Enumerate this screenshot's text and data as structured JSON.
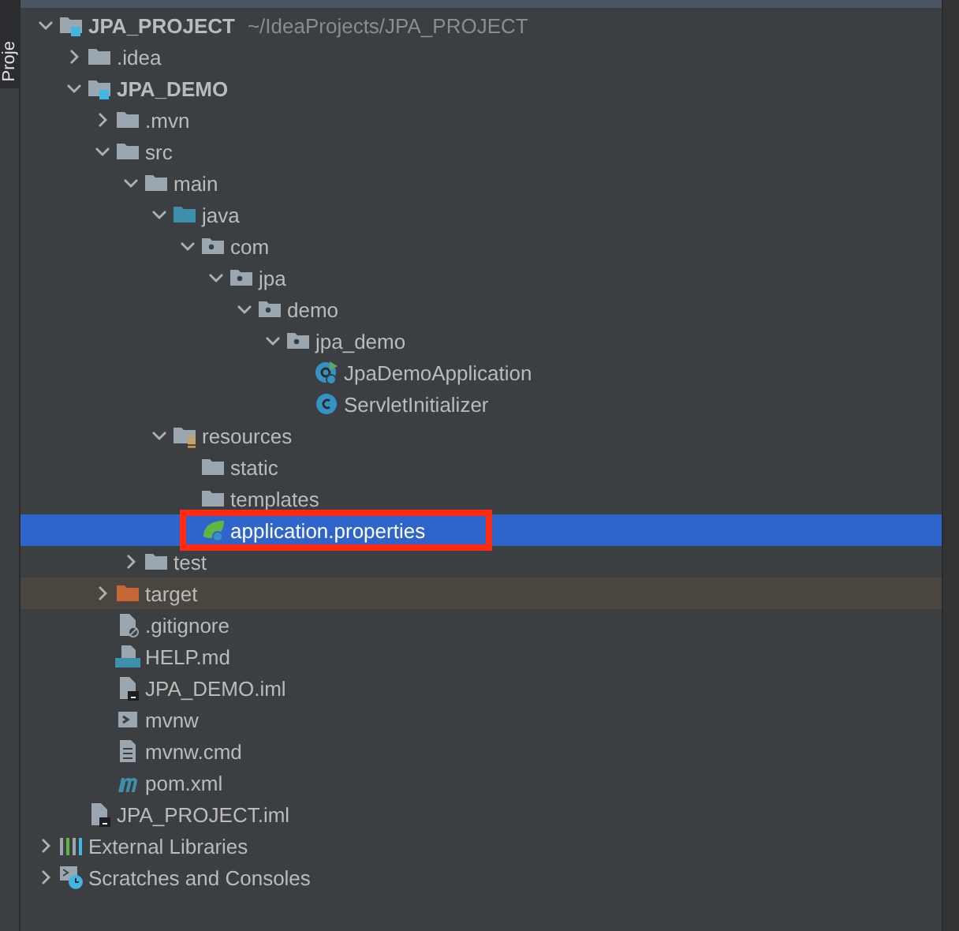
{
  "side_tab": {
    "label": "Proje"
  },
  "tree": [
    {
      "label": "JPA_PROJECT",
      "kind": "module",
      "path": "~/IdeaProjects/JPA_PROJECT",
      "expanded": true,
      "selected": false,
      "children": [
        {
          "label": ".idea",
          "kind": "folder",
          "expanded": false,
          "selected": false
        },
        {
          "label": "JPA_DEMO",
          "kind": "module",
          "expanded": true,
          "selected": false,
          "children": [
            {
              "label": ".mvn",
              "kind": "folder",
              "expanded": false,
              "selected": false
            },
            {
              "label": "src",
              "kind": "folder",
              "expanded": true,
              "selected": false,
              "children": [
                {
                  "label": "main",
                  "kind": "folder",
                  "expanded": true,
                  "selected": false,
                  "children": [
                    {
                      "label": "java",
                      "kind": "source",
                      "expanded": true,
                      "selected": false,
                      "children": [
                        {
                          "label": "com",
                          "kind": "package",
                          "expanded": true,
                          "selected": false,
                          "children": [
                            {
                              "label": "jpa",
                              "kind": "package",
                              "expanded": true,
                              "selected": false,
                              "children": [
                                {
                                  "label": "demo",
                                  "kind": "package",
                                  "expanded": true,
                                  "selected": false,
                                  "children": [
                                    {
                                      "label": "jpa_demo",
                                      "kind": "package",
                                      "expanded": true,
                                      "selected": false,
                                      "children": [
                                        {
                                          "label": "JpaDemoApplication",
                                          "kind": "main-class",
                                          "selected": false
                                        },
                                        {
                                          "label": "ServletInitializer",
                                          "kind": "class",
                                          "selected": false
                                        }
                                      ]
                                    }
                                  ]
                                }
                              ]
                            }
                          ]
                        }
                      ]
                    },
                    {
                      "label": "resources",
                      "kind": "resources",
                      "expanded": true,
                      "selected": false,
                      "children": [
                        {
                          "label": "static",
                          "kind": "folder",
                          "selected": false
                        },
                        {
                          "label": "templates",
                          "kind": "folder",
                          "selected": false
                        },
                        {
                          "label": "application.properties",
                          "kind": "properties",
                          "selected": true,
                          "annotated": true
                        }
                      ]
                    }
                  ]
                },
                {
                  "label": "test",
                  "kind": "folder",
                  "expanded": false,
                  "selected": false
                }
              ]
            },
            {
              "label": "target",
              "kind": "excluded",
              "expanded": false,
              "selected": false
            },
            {
              "label": ".gitignore",
              "kind": "ignore",
              "selected": false
            },
            {
              "label": "HELP.md",
              "kind": "markdown",
              "selected": false
            },
            {
              "label": "JPA_DEMO.iml",
              "kind": "iml",
              "selected": false
            },
            {
              "label": "mvnw",
              "kind": "shell",
              "selected": false
            },
            {
              "label": "mvnw.cmd",
              "kind": "text",
              "selected": false
            },
            {
              "label": "pom.xml",
              "kind": "maven",
              "selected": false
            }
          ]
        },
        {
          "label": "JPA_PROJECT.iml",
          "kind": "iml",
          "selected": false
        }
      ]
    },
    {
      "label": "External Libraries",
      "kind": "libraries",
      "expanded": false,
      "selected": false
    },
    {
      "label": "Scratches and Consoles",
      "kind": "scratches",
      "expanded": false,
      "selected": false
    }
  ]
}
